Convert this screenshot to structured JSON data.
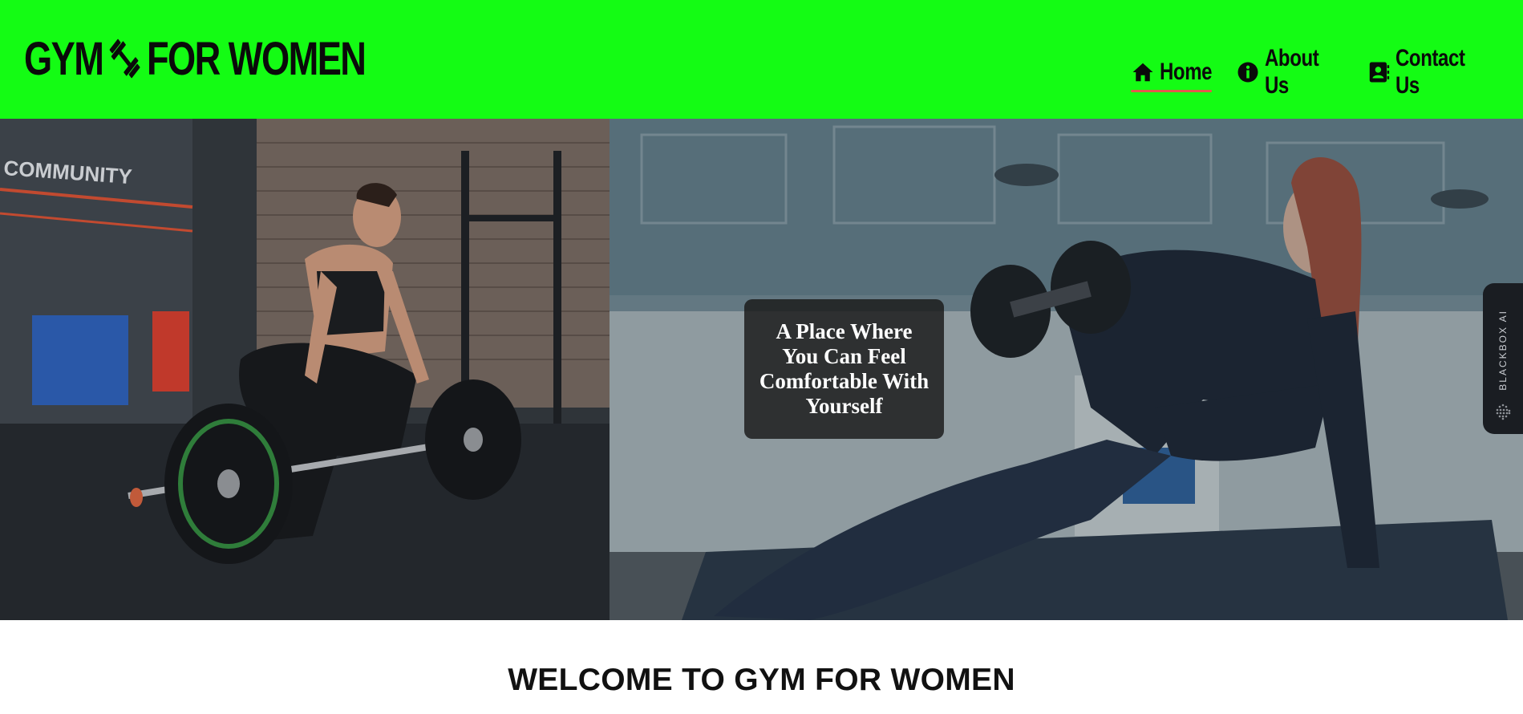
{
  "header": {
    "logo": {
      "part1": "GYM",
      "part2": "FOR WOMEN",
      "icon": "dumbbell-icon"
    },
    "bg_color": "#14fc14",
    "nav": [
      {
        "label": "Home",
        "icon": "home-icon",
        "active": true
      },
      {
        "label": "About Us",
        "icon": "info-circle-icon",
        "active": false
      },
      {
        "label": "Contact Us",
        "icon": "address-book-icon",
        "active": false
      }
    ],
    "active_underline_color": "#e3584c"
  },
  "hero": {
    "caption": "A Place Where You Can Feel Comfortable With Yourself",
    "left_image": "woman-deadlift-photo",
    "right_image": "woman-dumbbell-row-photo"
  },
  "side_widget": {
    "label": "BLACKBOX AI",
    "icon": "dots-sphere-icon"
  },
  "main": {
    "welcome_title": "WELCOME TO GYM FOR WOMEN"
  }
}
